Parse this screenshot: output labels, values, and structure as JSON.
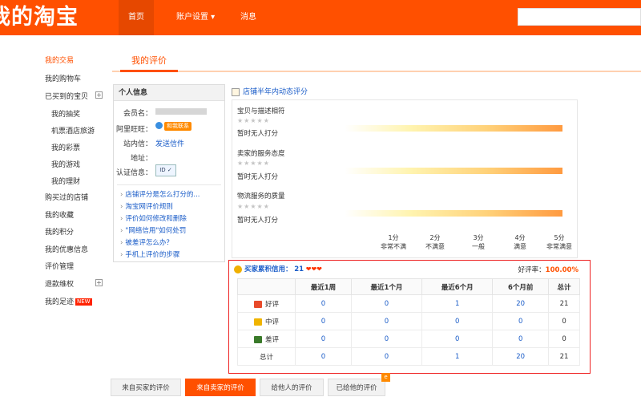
{
  "header": {
    "logo": "我的淘宝",
    "nav": [
      "首页",
      "账户设置 ▾",
      "消息"
    ]
  },
  "sidebar": {
    "items": [
      "我的交易",
      "我的购物车",
      "已买到的宝贝",
      "我的抽奖",
      "机票酒店旅游",
      "我的彩票",
      "我的游戏",
      "我的理财",
      "购买过的店铺",
      "我的收藏",
      "我的积分",
      "我的优惠信息",
      "评价管理",
      "退款维权",
      "我的足迹"
    ],
    "new_badge": "NEW"
  },
  "main": {
    "tab": "我的评价"
  },
  "personal_info": {
    "title": "个人信息",
    "member_label": "会员名：",
    "wangwang_label": "阿里旺旺：",
    "wangwang_value": "和我联系",
    "site_label": "站内信：",
    "site_value": "发送信件",
    "address_label": "地址：",
    "cert_label": "认证信息：",
    "help_links": [
      "店铺评分是怎么打分的...",
      "淘宝网评价规则",
      "评价如何修改和删除",
      "\"网络信用\"如何处罚",
      "被差评怎么办？",
      "手机上评价的步骤"
    ]
  },
  "dynamic_rating": {
    "title": "店铺半年内动态评分",
    "items": [
      {
        "label": "宝贝与描述相符",
        "status": "暂时无人打分",
        "stars": "★★★★★"
      },
      {
        "label": "卖家的服务态度",
        "status": "暂时无人打分",
        "stars": "★★★★★"
      },
      {
        "label": "物流服务的质量",
        "status": "暂时无人打分",
        "stars": "★★★★★"
      }
    ],
    "scale": [
      {
        "score": "1分",
        "desc": "非常不满"
      },
      {
        "score": "2分",
        "desc": "不满意"
      },
      {
        "score": "3分",
        "desc": "一般"
      },
      {
        "score": "4分",
        "desc": "满意"
      },
      {
        "score": "5分",
        "desc": "非常满意"
      }
    ]
  },
  "credit": {
    "buyer_label": "买家累积信用：",
    "buyer_value": "21",
    "hearts": "❤❤❤",
    "good_rate_label": "好评率：",
    "good_rate_value": "100.00%",
    "columns": [
      "",
      "最近1周",
      "最近1个月",
      "最近6个月",
      "6个月前",
      "总计"
    ],
    "rows": [
      {
        "label": "好评",
        "icon_color": "#e84a2a",
        "values": [
          "0",
          "0",
          "1",
          "20",
          "21"
        ]
      },
      {
        "label": "中评",
        "icon_color": "#f0b400",
        "values": [
          "0",
          "0",
          "0",
          "0",
          "0"
        ]
      },
      {
        "label": "差评",
        "icon_color": "#3a7a2a",
        "values": [
          "0",
          "0",
          "0",
          "0",
          "0"
        ]
      },
      {
        "label": "总计",
        "icon_color": "",
        "values": [
          "0",
          "0",
          "1",
          "20",
          "21"
        ]
      }
    ]
  },
  "bottom_tabs": [
    "来自买家的评价",
    "来自卖家的评价",
    "给他人的评价",
    "已给他的评价"
  ],
  "colors": {
    "brand": "#ff5000",
    "link": "#1a5cc8",
    "highlight_border": "#ee2222"
  }
}
